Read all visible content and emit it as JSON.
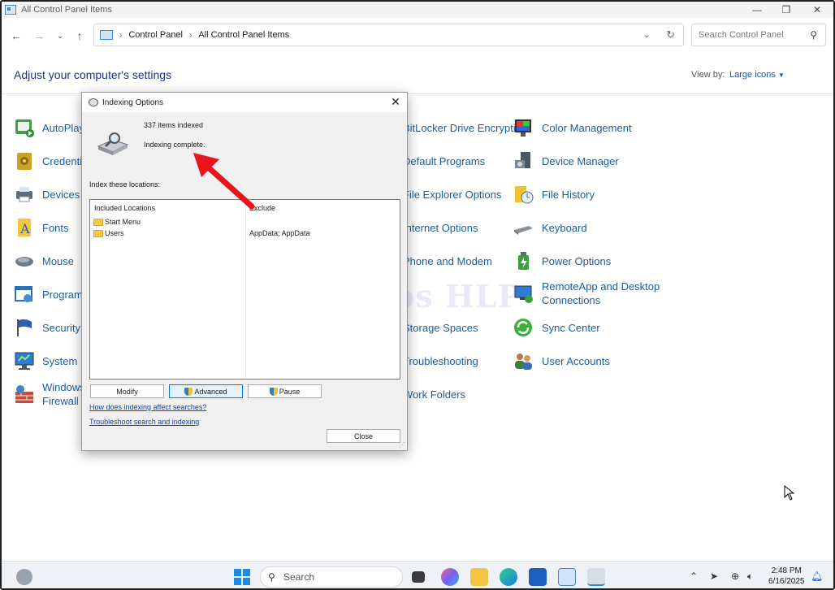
{
  "window": {
    "title": "All Control Panel Items"
  },
  "nav": {
    "breadcrumb": [
      "Control Panel",
      "All Control Panel Items"
    ],
    "search_placeholder": "Search Control Panel"
  },
  "page": {
    "heading": "Adjust your computer's settings",
    "view_by_label": "View by:",
    "view_by_value": "Large icons"
  },
  "items": {
    "autoplay": "AutoPlay",
    "credential": "Credential Manager",
    "devices": "Devices and Printers",
    "fonts": "Fonts",
    "mouse": "Mouse",
    "programs_features": "Programs and Features",
    "security": "Security and Maintenance",
    "system": "System",
    "firewall_line1": "Windows Defender",
    "firewall_line2": "Firewall",
    "bitlocker": "BitLocker Drive Encryption",
    "default_programs": "Default Programs",
    "explorer_options": "File Explorer Options",
    "internet_options": "Internet Options",
    "phone_modem": "Phone and Modem",
    "storage_spaces": "Storage Spaces",
    "troubleshooting": "Troubleshooting",
    "work_folders": "Work Folders",
    "color_mgmt": "Color Management",
    "device_mgr": "Device Manager",
    "file_history": "File History",
    "keyboard": "Keyboard",
    "power": "Power Options",
    "remoteapp_line1": "RemoteApp and Desktop",
    "remoteapp_line2": "Connections",
    "sync": "Sync Center",
    "user_accounts": "User Accounts"
  },
  "dialog": {
    "title": "Indexing Options",
    "count_text": "337 items indexed",
    "status_text": "Indexing complete.",
    "locations_label": "Index these locations:",
    "col_included": "Included Locations",
    "col_exclude": "Exclude",
    "locations": [
      {
        "name": "Start Menu",
        "exclude": ""
      },
      {
        "name": "Users",
        "exclude": "AppData; AppData"
      }
    ],
    "buttons": {
      "modify": "Modify",
      "advanced": "Advanced",
      "pause": "Pause",
      "close": "Close"
    },
    "links": {
      "how": "How does indexing affect searches?",
      "troubleshoot": "Troubleshoot search and indexing"
    }
  },
  "watermark": "IT Pros HLP",
  "taskbar": {
    "search_label": "Search",
    "time": "2:48 PM",
    "date": "6/16/2025"
  },
  "colors": {
    "accent": "#1a5d9e",
    "arrow": "#e8151b",
    "link": "#0645ad"
  }
}
